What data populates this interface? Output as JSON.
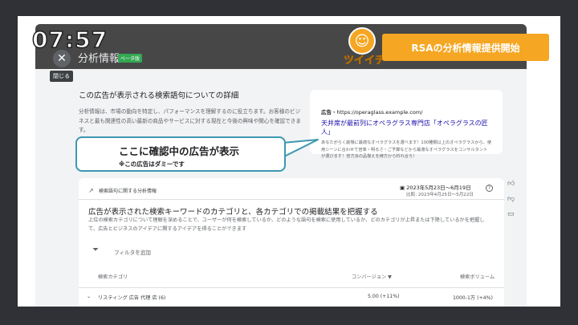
{
  "overlay": {
    "clock": "07:57",
    "logo_face": "☺",
    "logo_text": "ツイイチ",
    "banner": "RSAの分析情報提供開始"
  },
  "header": {
    "close_icon": "✕",
    "close_tooltip": "閉じる",
    "title": "分析情報",
    "beta": "ベータ版"
  },
  "intro": {
    "heading": "この広告が表示される検索語句についての詳細",
    "description": "分析情報は、市場の動向を特定し、パフォーマンスを理解するのに役立ちます。お客様のビジネスと最も関連性の高い最新の商品やサービスに対する現在と今後の興味や関心を確認できます。"
  },
  "ad": {
    "label": "広告",
    "url": "・https://operaglass.example.com/",
    "headline": "天井席が最前列にオペラグラス専門店「オペラグラスの匠人」",
    "description": "あなたがらく劇場に最適なオペラグラスを選べます！100種類以上のオペラグラスから、使用シーンに合わせて倍率・明るさ・ご予算などから最適なオペラグラスをコンサルタントが選びます！倍方派の品揃えを様方から料れ合ろ！"
  },
  "callout": {
    "main": "ここに確認中の広告が表示",
    "sub": "※この広告はダミーです"
  },
  "panel": {
    "label": "検索語句に関する分析情報",
    "date_range": "2023年5月23日～6月19日",
    "compare": "比較: 2023年4月25日～5月22日",
    "heading": "広告が表示された検索キーワードのカテゴリと、各カテゴリでの掲載結果を把握する",
    "sub": "上位の検索カテゴリについて理解を深めることで、ユーザーが何を検索しているか、どのような語句を検索に使用しているか、どのカテゴリが上昇または下降しているかを把握して、広告とビジネスのアイデアに関するアイデアを得ることができます",
    "filter": "フィルタを追加",
    "columns": [
      "検索カテゴリ",
      "コンバージョン ▼",
      "検索ボリューム"
    ],
    "row": {
      "category": "リスティング 広告 代理 店 (6)",
      "conversions": "5.00 (+11%)",
      "volume": "1000-1万 (+4%)"
    }
  }
}
